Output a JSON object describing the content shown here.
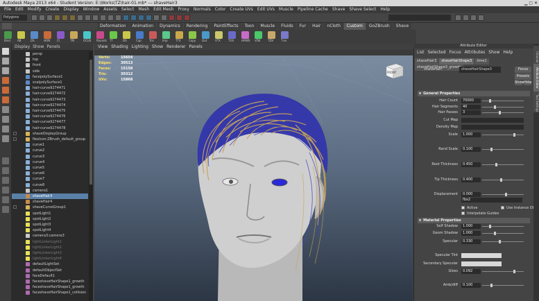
{
  "window": {
    "title": "Autodesk Maya 2013 x64 - Student Version: E:\\Works\\TZ\\hair-01.mb* --- shaveHair3"
  },
  "menubar": {
    "items": [
      "File",
      "Edit",
      "Modify",
      "Create",
      "Display",
      "Window",
      "Assets",
      "Select",
      "Mesh",
      "Edit Mesh",
      "Proxy",
      "Normals",
      "Color",
      "Create UVs",
      "Edit UVs",
      "Muscle",
      "Pipeline Cache",
      "Shave",
      "Shave Select",
      "Help"
    ]
  },
  "statusline": {
    "mode": "Polygons"
  },
  "shelf": {
    "tabs": [
      "Deformation",
      "Animation",
      "Dynamics",
      "Rendering",
      "PaintEffects",
      "Toon",
      "Muscle",
      "Fluids",
      "Fur",
      "Hair",
      "nCloth",
      "Custom",
      "GoZBrush",
      "Shave"
    ],
    "active_tab": "Custom",
    "labels": [
      "Bind",
      "AB",
      "DS",
      "HON",
      "CI",
      "TRI",
      "OCLN",
      "Rounds",
      "TT",
      "DS",
      "Cap",
      "Tris",
      "Imp",
      "TTX",
      "Copy",
      "Out",
      "VTX",
      "TGS",
      "HANIS",
      "VDK",
      "TDV",
      "T-av"
    ]
  },
  "outliner": {
    "menu": [
      "Display",
      "Show",
      "Panels"
    ],
    "items": [
      {
        "label": "persp",
        "icon": "camera"
      },
      {
        "label": "top",
        "icon": "camera"
      },
      {
        "label": "front",
        "icon": "camera"
      },
      {
        "label": "side",
        "icon": "camera"
      },
      {
        "label": "facepolySurface1",
        "icon": "mesh"
      },
      {
        "label": "scalpolySurface1",
        "icon": "mesh"
      },
      {
        "label": "hair-curve9274471",
        "icon": "curve"
      },
      {
        "label": "hair-curve9274472",
        "icon": "curve"
      },
      {
        "label": "hair-curve9274473",
        "icon": "curve"
      },
      {
        "label": "hair-curve9274474",
        "icon": "curve"
      },
      {
        "label": "hair-curve9274475",
        "icon": "curve"
      },
      {
        "label": "hair-curve9274476",
        "icon": "curve"
      },
      {
        "label": "hair-curve9274477",
        "icon": "curve"
      },
      {
        "label": "hair-curve9274478",
        "icon": "curve"
      },
      {
        "label": "shaveDisplayGroup",
        "icon": "group"
      },
      {
        "label": "flexIcon:ZBrush_default_group",
        "icon": "group"
      },
      {
        "label": "curve1",
        "icon": "curve"
      },
      {
        "label": "curve2",
        "icon": "curve"
      },
      {
        "label": "curve3",
        "icon": "curve"
      },
      {
        "label": "curve4",
        "icon": "curve"
      },
      {
        "label": "curve5",
        "icon": "curve"
      },
      {
        "label": "curve6",
        "icon": "curve"
      },
      {
        "label": "curve7",
        "icon": "curve"
      },
      {
        "label": "curve8",
        "icon": "curve"
      },
      {
        "label": "camera1",
        "icon": "camera"
      },
      {
        "label": "shaveHair3",
        "icon": "hair",
        "selected": true
      },
      {
        "label": "shaveHair4",
        "icon": "hair"
      },
      {
        "label": "shaveCurveGroup1",
        "icon": "group"
      },
      {
        "label": "spotLight1",
        "icon": "light"
      },
      {
        "label": "spotLight2",
        "icon": "light"
      },
      {
        "label": "spotLight3",
        "icon": "light"
      },
      {
        "label": "spotLight4",
        "icon": "light"
      },
      {
        "label": "camera3:camera3",
        "icon": "camera"
      },
      {
        "label": "lightLinkerLight1",
        "icon": "light",
        "dim": true
      },
      {
        "label": "lightLinkerLight2",
        "icon": "light",
        "dim": true
      },
      {
        "label": "lightLinkerLight3",
        "icon": "light",
        "dim": true
      },
      {
        "label": "lightLinkerLight4",
        "icon": "light",
        "dim": true
      },
      {
        "label": "defaultLightSet",
        "icon": "set"
      },
      {
        "label": "defaultObjectSet",
        "icon": "set"
      },
      {
        "label": "faceDefault1",
        "icon": "set"
      },
      {
        "label": "faceshaveHairShape1_growth",
        "icon": "set"
      },
      {
        "label": "faceshaveHairShape1_growth",
        "icon": "set"
      },
      {
        "label": "faceshaveHairShape1_collision",
        "icon": "set"
      }
    ]
  },
  "viewport": {
    "menu": [
      "View",
      "Shading",
      "Lighting",
      "Show",
      "Renderer",
      "Panels"
    ],
    "hud": [
      {
        "label": "Verts:",
        "value": "15654"
      },
      {
        "label": "Edges:",
        "value": "30513"
      },
      {
        "label": "Faces:",
        "value": "15158"
      },
      {
        "label": "Tris:",
        "value": "30312"
      },
      {
        "label": "UVs:",
        "value": "15868"
      }
    ],
    "viewcube": "FRONT"
  },
  "attribute_editor": {
    "title": "Attribute Editor",
    "menu": [
      "List",
      "Selected",
      "Focus",
      "Attributes",
      "Show",
      "Help"
    ],
    "tabs": [
      "shaveHair3",
      "shaveHairShape3",
      "time1",
      "shaveHairShape3_growth"
    ],
    "node_label": "shaveHair:",
    "node_value": "shaveHairShape3",
    "focus_btn": "Focus",
    "presets_btn": "Presets",
    "show_btn": "Show",
    "hide_btn": "Hide",
    "general": {
      "header": "General Properties",
      "rows": [
        {
          "label": "Hair Count",
          "value": "70000"
        },
        {
          "label": "Hair Segments",
          "value": "40"
        },
        {
          "label": "Hair Passes",
          "value": "3"
        },
        {
          "label": "Cut Map",
          "value": ""
        },
        {
          "label": "Density Map",
          "value": ""
        },
        {
          "label": "Scale",
          "value": "1.000"
        },
        {
          "label": "Rand Scale",
          "value": "0.100"
        },
        {
          "label": "Root Thickness",
          "value": "0.450"
        },
        {
          "label": "Tip Thickness",
          "value": "0.400"
        },
        {
          "label": "Displacement",
          "value": "0.000"
        }
      ],
      "extra_value": "fbx2",
      "active_label": "Active",
      "interp_label": "Interpolate Guides",
      "instance_label": "Use Instance Ob"
    },
    "material": {
      "header": "Material Properties",
      "rows": [
        {
          "label": "Self Shadow",
          "value": "1.000"
        },
        {
          "label": "Geom Shadow",
          "value": "1.000"
        },
        {
          "label": "Specular",
          "value": "0.330"
        },
        {
          "label": "Specular Tint",
          "value": ""
        },
        {
          "label": "Secondary Specular",
          "value": ""
        },
        {
          "label": "Gloss",
          "value": "0.092"
        },
        {
          "label": "Amb/diff",
          "value": "0.100"
        }
      ]
    },
    "side_tabs": [
      "Channel Box / Layer Editor",
      "Attribute Editor",
      "Tool Settings"
    ]
  }
}
